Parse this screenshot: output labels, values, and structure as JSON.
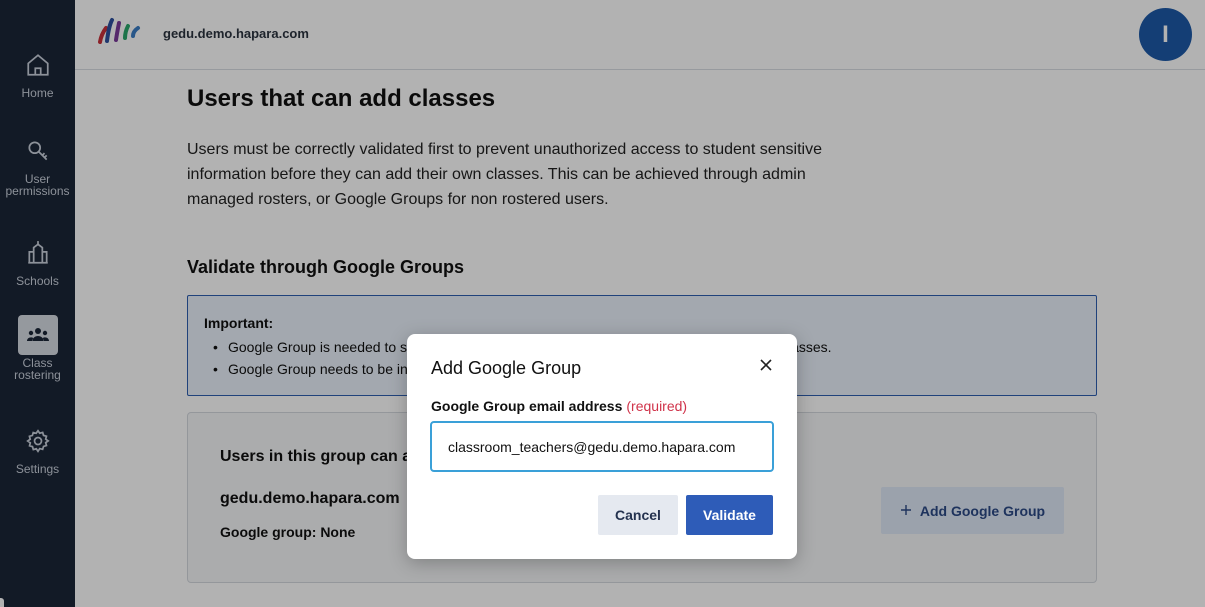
{
  "sidebar": {
    "items": [
      {
        "label": "Home",
        "icon": "home-icon"
      },
      {
        "label": "User permissions",
        "icon": "key-icon"
      },
      {
        "label": "Schools",
        "icon": "school-icon"
      },
      {
        "label": "Class rostering",
        "icon": "people-icon",
        "active": true
      },
      {
        "label": "Settings",
        "icon": "gear-icon"
      }
    ]
  },
  "header": {
    "domain": "gedu.demo.hapara.com",
    "avatar_initial": "I"
  },
  "main": {
    "title": "Users that can add classes",
    "intro": "Users must be correctly validated first to prevent unauthorized access to student sensitive information before they can add their own classes. This can be achieved through admin managed rosters, or Google Groups for non rostered users.",
    "section_title": "Validate through Google Groups",
    "important": {
      "title": "Important:",
      "bullets": [
        {
          "start": "Google Group is needed to s",
          "end": "lasses."
        },
        {
          "start": "Google Group needs to be in",
          "end": ""
        }
      ]
    },
    "group_card": {
      "title": "Users in this group can a",
      "domain": "gedu.demo.hapara.com",
      "group": "Google group: None",
      "add_button": "Add Google Group"
    }
  },
  "modal": {
    "title": "Add Google Group",
    "field_label": "Google Group email address",
    "required_text": "(required)",
    "input_value": "classroom_teachers@gedu.demo.hapara.com",
    "cancel_label": "Cancel",
    "validate_label": "Validate"
  },
  "colors": {
    "sidebar_bg": "#1b2637",
    "accent": "#2e5cb8",
    "avatar": "#1e5aa8",
    "required": "#d0334a",
    "focus": "#3aa0d8"
  }
}
